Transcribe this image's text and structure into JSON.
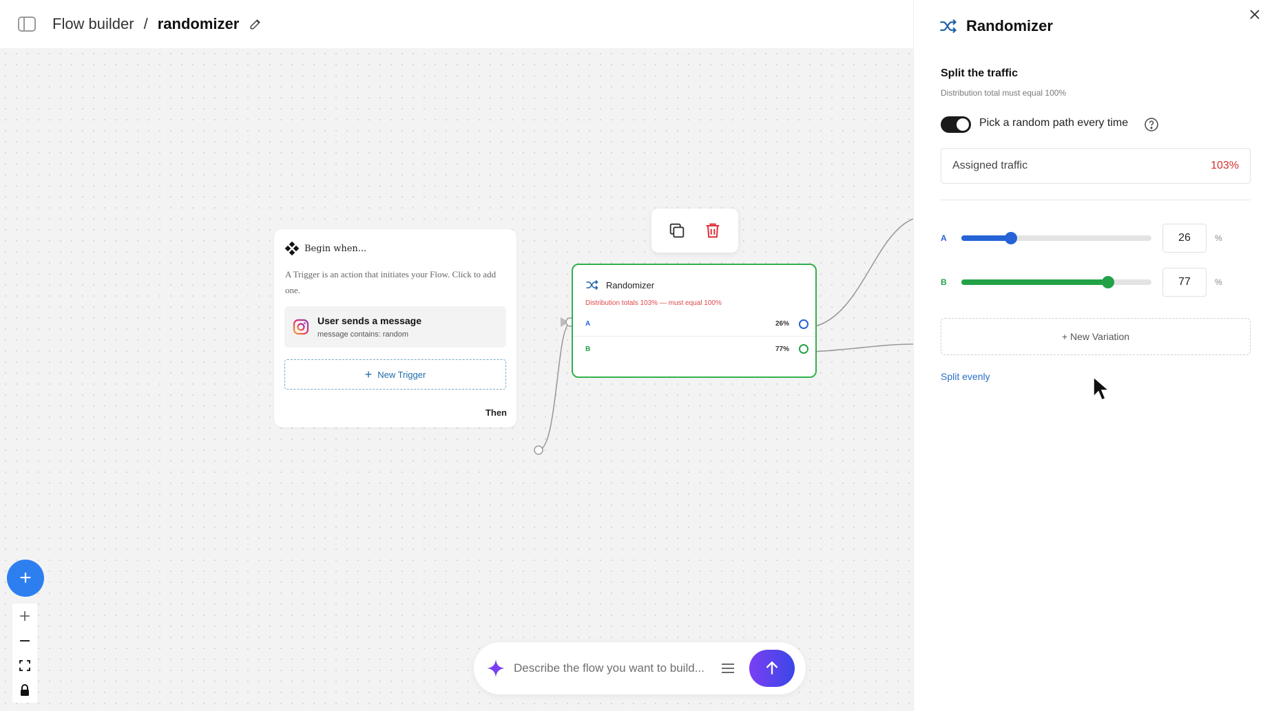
{
  "header": {
    "section": "Flow builder",
    "separator": "/",
    "flow_name": "randomizer"
  },
  "trigger_card": {
    "title": "Begin when...",
    "description": "A Trigger is an action that initiates your Flow. Click to add one.",
    "item_title": "User sends a message",
    "item_subtitle": "message contains: random",
    "new_trigger_label": "New Trigger",
    "then_label": "Then"
  },
  "randomizer_node": {
    "title": "Randomizer",
    "error": "Distribution totals 103% — must equal 100%",
    "rows": [
      {
        "letter": "A",
        "percent": "26%",
        "color": "#2563d6"
      },
      {
        "letter": "B",
        "percent": "77%",
        "color": "#22a246"
      }
    ]
  },
  "prompt": {
    "placeholder": "Describe the flow you want to build..."
  },
  "panel": {
    "title": "Randomizer",
    "section_title": "Split the traffic",
    "section_sub": "Distribution total must equal 100%",
    "toggle_label": "Pick a random path every time",
    "toggle_on": true,
    "assigned_label": "Assigned traffic",
    "assigned_value": "103%",
    "variations": [
      {
        "letter": "A",
        "value": "26",
        "unit": "%",
        "color": "#2563d6",
        "level": 0.26
      },
      {
        "letter": "B",
        "value": "77",
        "unit": "%",
        "color": "#22a246",
        "level": 0.77
      }
    ],
    "new_variation_label": "+ New Variation",
    "split_evenly_label": "Split evenly"
  },
  "colors": {
    "accent_blue": "#2d7ff0",
    "node_border": "#2fb04a",
    "error_red": "#d43030"
  }
}
